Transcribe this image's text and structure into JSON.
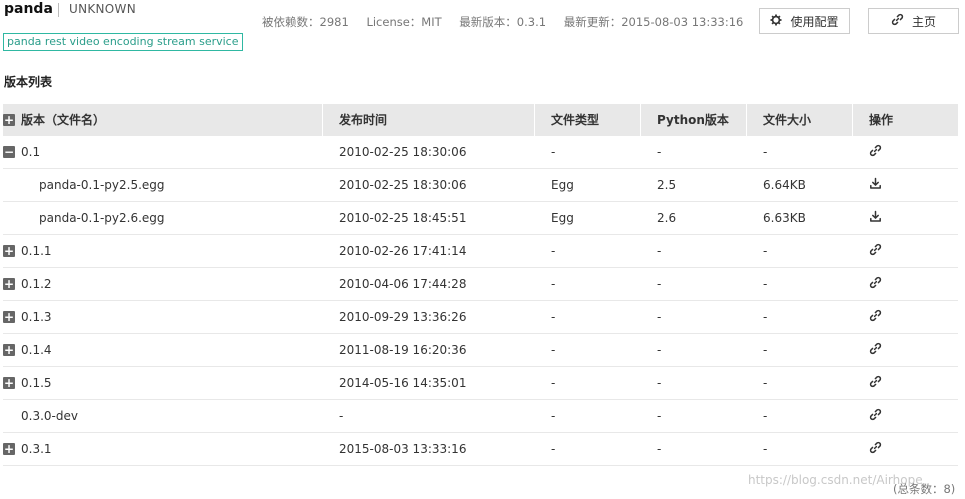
{
  "header": {
    "package_name": "panda",
    "license_tag": "UNKNOWN",
    "description": "panda rest video encoding stream service",
    "dependents": "被依赖数：2981",
    "license": "License：MIT",
    "latest_version": "最新版本：0.3.1",
    "last_updated": "最新更新：2015-08-03 13:33:16",
    "config_button": "使用配置",
    "home_button": "主页"
  },
  "section_title": "版本列表",
  "table": {
    "headers": [
      "版本（文件名）",
      "发布时间",
      "文件类型",
      "Python版本",
      "文件大小",
      "操作"
    ],
    "rows": [
      {
        "name": "0.1",
        "date": "2010-02-25 18:30:06",
        "type": "-",
        "python": "-",
        "size": "-",
        "kind": "version",
        "toggle": "minus",
        "action": "link-icon"
      },
      {
        "name": "panda-0.1-py2.5.egg",
        "date": "2010-02-25 18:30:06",
        "type": "Egg",
        "python": "2.5",
        "size": "6.64KB",
        "kind": "file",
        "toggle": "",
        "action": "download-icon"
      },
      {
        "name": "panda-0.1-py2.6.egg",
        "date": "2010-02-25 18:45:51",
        "type": "Egg",
        "python": "2.6",
        "size": "6.63KB",
        "kind": "file",
        "toggle": "",
        "action": "download-icon"
      },
      {
        "name": "0.1.1",
        "date": "2010-02-26 17:41:14",
        "type": "-",
        "python": "-",
        "size": "-",
        "kind": "version",
        "toggle": "plus",
        "action": "link-icon"
      },
      {
        "name": "0.1.2",
        "date": "2010-04-06 17:44:28",
        "type": "-",
        "python": "-",
        "size": "-",
        "kind": "version",
        "toggle": "plus",
        "action": "link-icon"
      },
      {
        "name": "0.1.3",
        "date": "2010-09-29 13:36:26",
        "type": "-",
        "python": "-",
        "size": "-",
        "kind": "version",
        "toggle": "plus",
        "action": "link-icon"
      },
      {
        "name": "0.1.4",
        "date": "2011-08-19 16:20:36",
        "type": "-",
        "python": "-",
        "size": "-",
        "kind": "version",
        "toggle": "plus",
        "action": "link-icon"
      },
      {
        "name": "0.1.5",
        "date": "2014-05-16 14:35:01",
        "type": "-",
        "python": "-",
        "size": "-",
        "kind": "version",
        "toggle": "plus",
        "action": "link-icon"
      },
      {
        "name": "0.3.0-dev",
        "date": "-",
        "type": "-",
        "python": "-",
        "size": "-",
        "kind": "version",
        "toggle": "",
        "action": "link-icon"
      },
      {
        "name": "0.3.1",
        "date": "2015-08-03 13:33:16",
        "type": "-",
        "python": "-",
        "size": "-",
        "kind": "version",
        "toggle": "plus",
        "action": "link-icon"
      }
    ]
  },
  "footer": {
    "total": "(总条数：8)",
    "watermark": "https://blog.csdn.net/Airhope"
  },
  "colors": {
    "accent": "#2fb8a2",
    "header_bg": "#e8e8e8",
    "toggle": "#666666"
  }
}
